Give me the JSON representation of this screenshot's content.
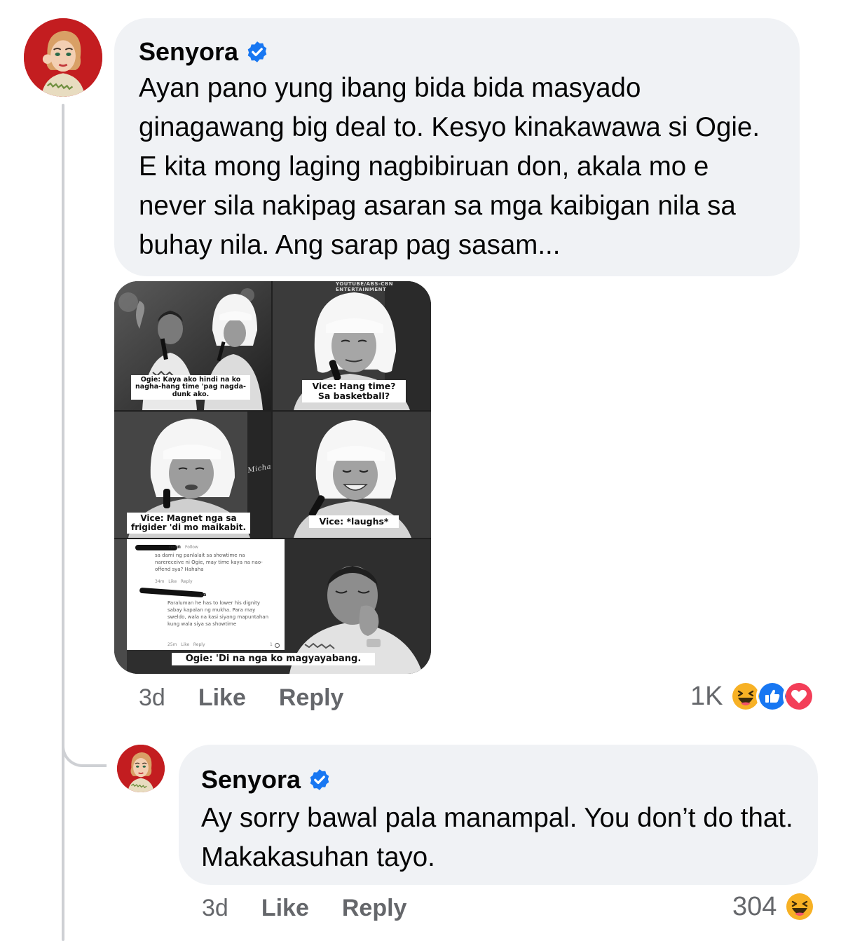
{
  "comment": {
    "author": "Senyora",
    "text": "Ayan pano yung ibang bida bida masyado ginagawang big deal to. Kesyo kinakawawa si Ogie. E kita mong laging nagbibiruan don, akala mo e never sila nakipag asaran sa mga kaibigan nila sa buhay nila. Ang sarap pag sasam...",
    "time": "3d",
    "like_label": "Like",
    "reply_label": "Reply",
    "reaction_count": "1K",
    "reactions": [
      "haha-icon",
      "like-icon",
      "love-icon"
    ],
    "attachment": {
      "watermark": "YOUTUBE/ABS-CBN ENTERTAINMENT",
      "signature": "Michaelangelo",
      "captions": {
        "p1": "Ogie: Kaya ako hindi na ko nagha-hang time 'pag nagda-dunk ako.",
        "p2": "Vice: Hang time? Sa basketball?",
        "p3": "Vice: Magnet nga sa frigider 'di mo maikabit.",
        "p4": "Vice: *laughs*",
        "p5": "Ogie: 'Di na nga ko magyayabang."
      },
      "embedded_screenshot": {
        "c1_name": "man",
        "c1_follow": "Follow",
        "c1_text": "sa dami ng panlalait sa showtime na narereceive ni Ogie, may time kaya na nao-offend sya? Hahaha",
        "c1_meta": "34m   Like   Reply",
        "c2_name": "va",
        "c2_text": "Paraluman he has to lower his dignity sabay kapalan ng mukha. Para may sweldo, wala na kasi siyang mapuntahan kung wala siya sa showtime",
        "c2_meta": "25m   Like   Reply",
        "c2_count": "1"
      }
    }
  },
  "reply": {
    "author": "Senyora",
    "text": "Ay sorry bawal pala manampal. You don’t do that. Makakasuhan tayo.",
    "time": "3d",
    "like_label": "Like",
    "reply_label": "Reply",
    "reaction_count": "304",
    "reactions": [
      "haha-icon"
    ]
  },
  "colors": {
    "bubble": "#f0f2f5",
    "verified": "#1877f2",
    "meta_text": "#65676b",
    "avatar_bg": "#c31d20",
    "haha": "#f7b125",
    "like": "#1877f2",
    "love": "#f33e58"
  }
}
